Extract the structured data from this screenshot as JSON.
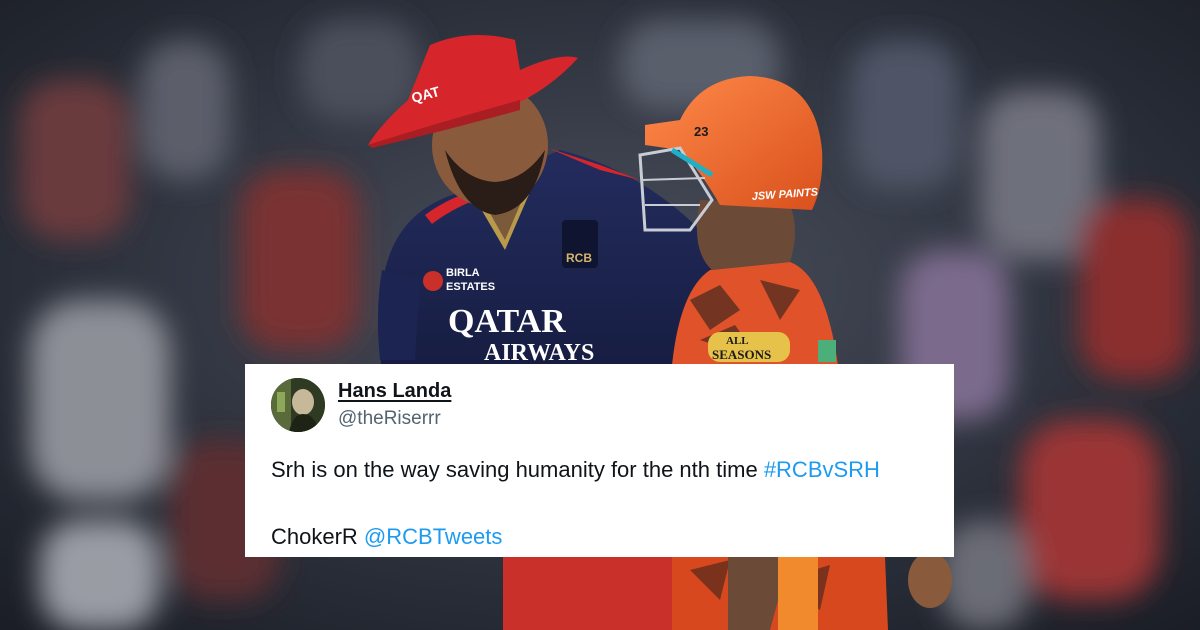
{
  "photo": {
    "rcb_hat_text": "QAT",
    "rcb_jersey_sponsor_line1": "QATAR",
    "rcb_jersey_sponsor_line2": "AIRWAYS",
    "rcb_chest_sponsor_line1": "BIRLA",
    "rcb_chest_sponsor_line2": "ESTATES",
    "rcb_crest_text": "RCB",
    "srh_helmet_number": "23",
    "srh_helmet_brand": "JSW PAINTS",
    "srh_jersey_sponsor_line1": "ALL",
    "srh_jersey_sponsor_line2": "SEASONS",
    "colors": {
      "rcb_red": "#d6262b",
      "rcb_navy": "#1c2452",
      "srh_orange": "#f26a2a"
    }
  },
  "tweet": {
    "display_name": "Hans Landa",
    "handle": "@theRiserrr",
    "text_line1": "Srh is on the way saving humanity for the nth time ",
    "hashtag": "#RCBvSRH",
    "text_line2": "ChokerR ",
    "mention": "@RCBTweets",
    "colors": {
      "link": "#1d9bf0",
      "text": "#0f1419",
      "handle": "#536471"
    }
  }
}
